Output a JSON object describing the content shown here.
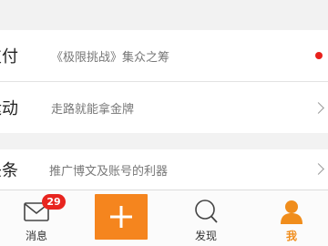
{
  "list": {
    "rows": [
      {
        "title": "支付",
        "desc": "《极限挑战》集众之筹"
      },
      {
        "title": "运动",
        "desc": "走路就能拿金牌"
      },
      {
        "title": "头条",
        "desc": "推广博文及账号的利器"
      }
    ]
  },
  "tabbar": {
    "messages": {
      "label": "消息",
      "badge": "29"
    },
    "discover": {
      "label": "发现"
    },
    "me": {
      "label": "我"
    }
  },
  "colors": {
    "accent": "#f5851e",
    "badge": "#e8251f",
    "active_tab": "#f08d1c"
  }
}
